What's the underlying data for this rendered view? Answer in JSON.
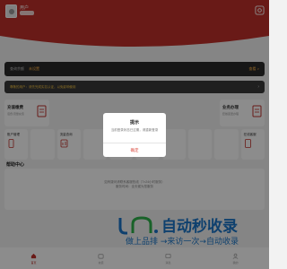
{
  "header": {
    "user_name": "用户",
    "brand_color": "#c0312a"
  },
  "search": {
    "label": "查询余额",
    "value": "未设置",
    "action": "查看 >"
  },
  "notice": {
    "text": "尊敬的用户：请先完成实名认证，以免影响使用",
    "arrow": "›"
  },
  "cards": {
    "left": {
      "title": "充值缴费",
      "subtitle": "话费/流量充值",
      "icon": "document-icon"
    },
    "right": {
      "title": "业务办理",
      "subtitle": "套餐变更办理",
      "icon": "document-icon"
    }
  },
  "grid": [
    {
      "label": "账户管理",
      "icon": "phone-icon"
    },
    {
      "label": "",
      "icon": ""
    },
    {
      "label": "流量查询",
      "icon": "chart-icon"
    },
    {
      "label": "",
      "icon": ""
    },
    {
      "label": "",
      "icon": ""
    },
    {
      "label": "积分兑换",
      "icon": "gift-icon"
    },
    {
      "label": "",
      "icon": ""
    },
    {
      "label": "",
      "icon": ""
    },
    {
      "label": "",
      "icon": ""
    },
    {
      "label": "在线客服",
      "icon": "doc-icon"
    }
  ],
  "help": {
    "title": "帮助中心",
    "line1": "如有疑问请联系客服热线（7×24小时服务）",
    "line2": "服务时间：全天候为您服务"
  },
  "watermark": {
    "main": "自动秒收录",
    "sub": "做上品排 →来访一次→自动收录"
  },
  "tabs": [
    {
      "label": "首页",
      "icon": "home-icon",
      "active": true
    },
    {
      "label": "充值",
      "icon": "wallet-icon",
      "active": false
    },
    {
      "label": "消息",
      "icon": "message-icon",
      "active": false
    },
    {
      "label": "我的",
      "icon": "user-icon",
      "active": false
    }
  ],
  "modal": {
    "title": "提示",
    "message": "当前登录状态已过期，请重新登录",
    "confirm": "确定"
  }
}
